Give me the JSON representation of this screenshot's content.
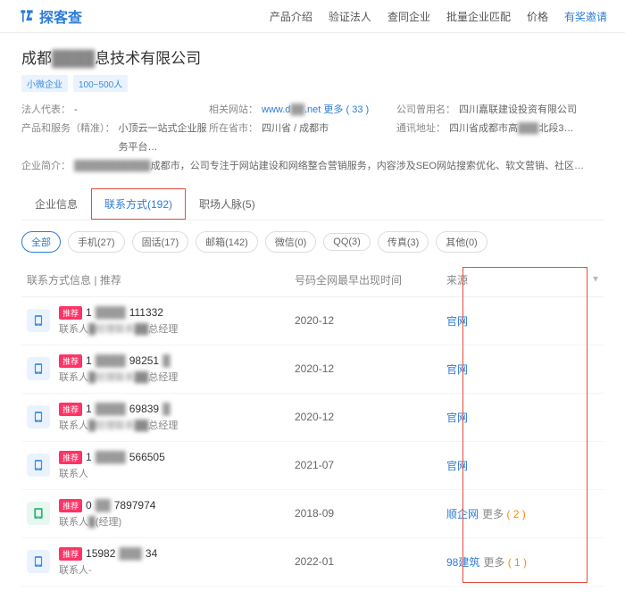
{
  "logo": "探客查",
  "nav": [
    "产品介绍",
    "验证法人",
    "查同企业",
    "批量企业匹配",
    "价格",
    "有奖邀请"
  ],
  "company": {
    "prefix": "成都",
    "masked": "████",
    "suffix": "息技术有限公司",
    "tags": [
      "小微企业",
      "100~500人"
    ]
  },
  "info": {
    "r1": {
      "l1": "法人代表：",
      "v1": "-",
      "l2": "相关网站：",
      "v2a": "www.d",
      "v2b": "██",
      "v2c": ".net",
      "v2more": "更多 ( 33 )",
      "l3": "公司曾用名：",
      "v3": "四川嘉联建设投资有限公司"
    },
    "r2": {
      "l1": "产品和服务（精准）：",
      "v1": "小顶云一站式企业服务平台…",
      "l2": "所在省市：",
      "v2": "四川省 / 成都市",
      "l3": "通讯地址：",
      "v3a": "四川省成都市高",
      "v3b": "███",
      "v3c": "北段3…"
    },
    "r3": {
      "l1": "企业简介：",
      "v1a": "███████████",
      "v1b": "成都市，公司专注于网站建设和网络整合营销服务，内容涉及SEO网站搜索优化、软文营销、社区…"
    }
  },
  "tabs": [
    "企业信息",
    "联系方式(192)",
    "职场人脉(5)"
  ],
  "filters": [
    "全部",
    "手机(27)",
    "固话(17)",
    "邮箱(142)",
    "微信(0)",
    "QQ(3)",
    "传真(3)",
    "其他(0)"
  ],
  "thead": {
    "info": "联系方式信息",
    "rec": "推荐",
    "time": "号码全网最早出现时间",
    "src": "来源"
  },
  "badge": "推荐",
  "rows": [
    {
      "ic": "ph",
      "n1": "1",
      "nb": "████",
      "n2": "111332",
      "sub1": "联系人",
      "subb": "█经理联系██",
      "sub2": "总经理",
      "time": "2020-12",
      "src": "官网",
      "more": "",
      "cnt": ""
    },
    {
      "ic": "ph",
      "n1": "1",
      "nb": "████",
      "n2": "98251",
      "n3": "█",
      "sub1": "联系人",
      "subb": "█经理联系██",
      "sub2": "总经理",
      "time": "2020-12",
      "src": "官网",
      "more": "",
      "cnt": ""
    },
    {
      "ic": "ph",
      "n1": "1",
      "nb": "████",
      "n2": "69839",
      "n3": "█",
      "sub1": "联系人",
      "subb": "█经理联系██",
      "sub2": "总经理",
      "time": "2020-12",
      "src": "官网",
      "more": "",
      "cnt": ""
    },
    {
      "ic": "ph",
      "n1": "1",
      "nb": "████",
      "n2": "566505",
      "sub1": "联系人",
      "subb": "",
      "sub2": "",
      "time": "2021-07",
      "src": "官网",
      "more": "",
      "cnt": ""
    },
    {
      "ic": "mb",
      "n1": "0",
      "nb": "██",
      "n2": "7897974",
      "sub1": "联系人",
      "subb": "█",
      "sub2": "(经理)",
      "time": "2018-09",
      "src": "顺企网",
      "more": "更多",
      "cnt": "( 2 )"
    },
    {
      "ic": "ph",
      "n1": "15982",
      "nb": "███",
      "n2": "34",
      "sub1": "联系人",
      "subb": "",
      "sub2": "-",
      "time": "2022-01",
      "src": "98建筑",
      "more": "更多",
      "cnt": "( 1 )"
    }
  ]
}
